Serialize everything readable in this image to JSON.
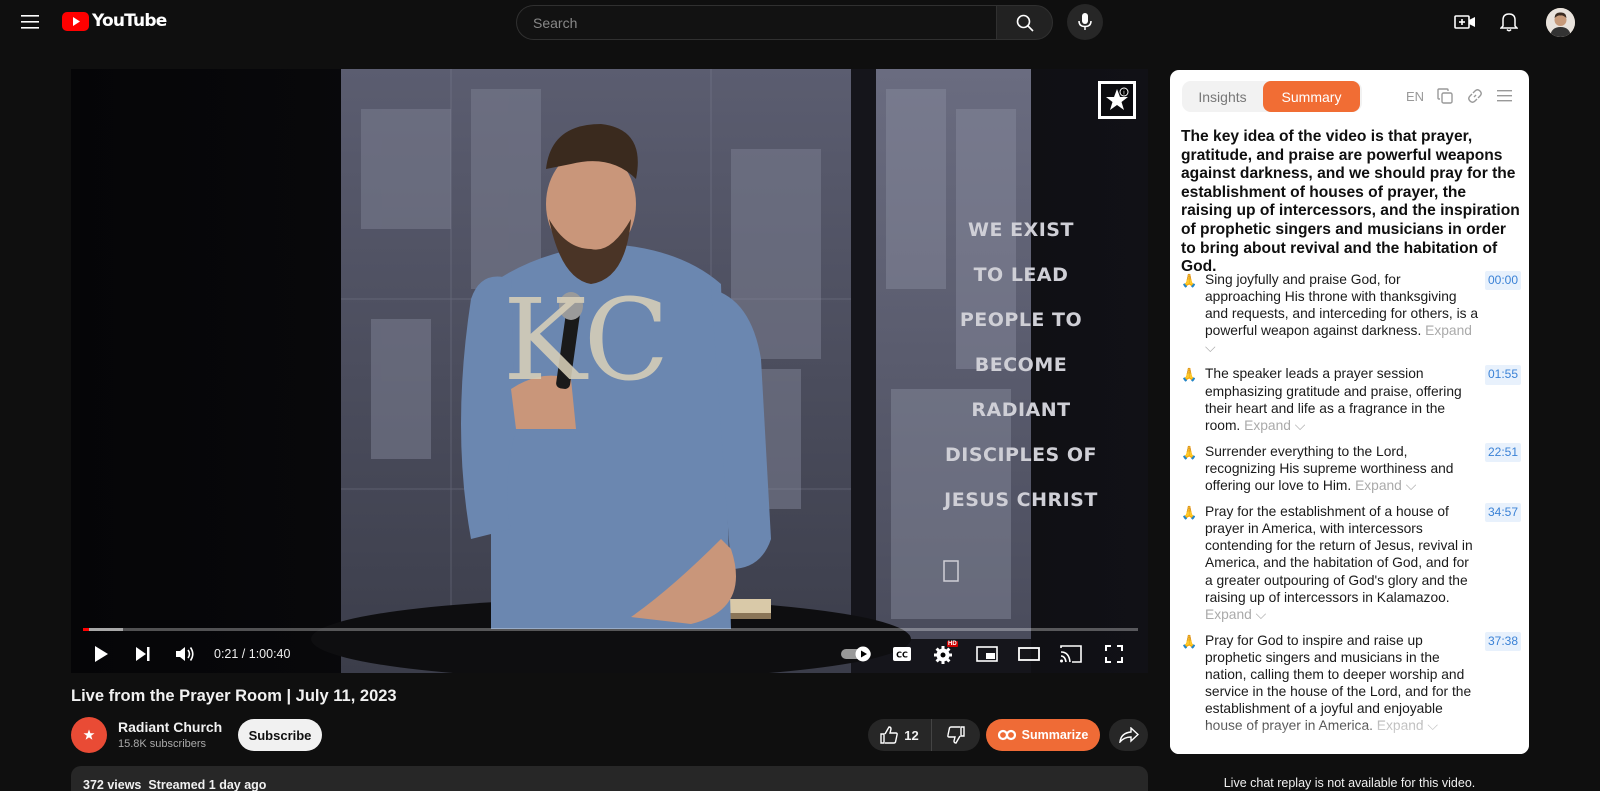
{
  "header": {
    "logo_text": "YouTube",
    "search_placeholder": "Search"
  },
  "player": {
    "banner_lines": [
      "WE EXIST",
      "TO LEAD",
      "PEOPLE TO",
      "BECOME",
      "RADIANT",
      "DISCIPLES OF",
      "JESUS CHRIST"
    ],
    "shirt_text": "KC",
    "time_display": "0:21 / 1:00:40",
    "progress_fraction": 0.0058,
    "buffered_fraction": 0.038,
    "hd_badge": "HD"
  },
  "video": {
    "title": "Live from the Prayer Room | July 11, 2023",
    "channel_name": "Radiant Church",
    "subscribers": "15.8K subscribers",
    "subscribe_label": "Subscribe",
    "like_count": "12",
    "summarize_label": "Summarize",
    "views": "372 views",
    "streamed": "Streamed 1 day ago"
  },
  "summary_panel": {
    "tab_insights": "Insights",
    "tab_summary": "Summary",
    "language": "EN",
    "key_idea": "The key idea of the video is that prayer, gratitude, and praise are powerful weapons against darkness, and we should pray for the establishment of houses of prayer, the raising up of intercessors, and the inspiration of prophetic singers and musicians in order to bring about revival and the habitation of God.",
    "expand_label": "Expand",
    "items": [
      {
        "emoji": "🙏",
        "text": "Sing joyfully and praise God, for approaching His throne with thanksgiving and requests, and interceding for others, is a powerful weapon against darkness.",
        "timestamp": "00:00"
      },
      {
        "emoji": "🙏",
        "text": "The speaker leads a prayer session emphasizing gratitude and praise, offering their heart and life as a fragrance in the room.",
        "timestamp": "01:55"
      },
      {
        "emoji": "🙏",
        "text": "Surrender everything to the Lord, recognizing His supreme worthiness and offering our love to Him.",
        "timestamp": "22:51"
      },
      {
        "emoji": "🙏",
        "text": "Pray for the establishment of a house of prayer in America, with intercessors contending for the return of Jesus, revival in America, and the habitation of God, and for a greater outpouring of God's glory and the raising up of intercessors in Kalamazoo.",
        "timestamp": "34:57"
      },
      {
        "emoji": "🙏",
        "text": "Pray for God to inspire and raise up prophetic singers and musicians in the nation, calling them to deeper worship and service in the house of the Lord, and for the establishment of a joyful and enjoyable house of prayer in America.",
        "timestamp": "37:38"
      }
    ]
  },
  "chat_note": "Live chat replay is not available for this video.",
  "colors": {
    "yt_red": "#ff0000",
    "accent_orange": "#f16d34",
    "timestamp_blue": "#3b82d6"
  }
}
